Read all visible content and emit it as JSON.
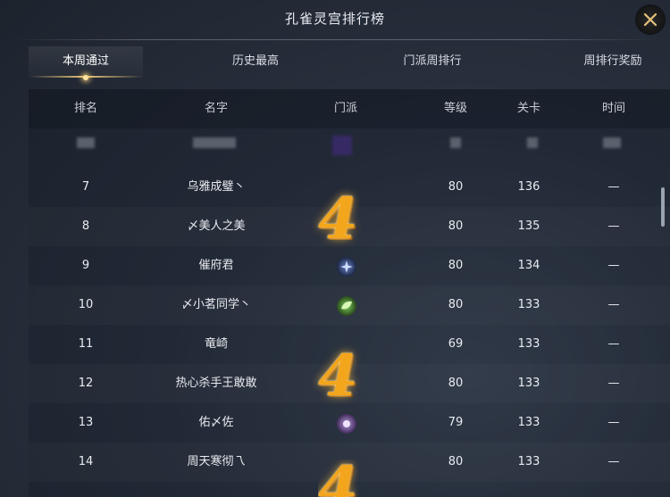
{
  "window": {
    "title": "孔雀灵宫排行榜"
  },
  "tabs": [
    {
      "label": "本周通过",
      "active": true
    },
    {
      "label": "历史最高",
      "active": false
    },
    {
      "label": "门派周排行",
      "active": false
    },
    {
      "label": "周排行奖励",
      "active": false
    }
  ],
  "table": {
    "headers": {
      "rank": "排名",
      "name": "名字",
      "sect": "门派",
      "level": "等级",
      "stage": "关卡",
      "time": "时间"
    },
    "rows": [
      {
        "rank": "7",
        "name": "乌雅成璧丶",
        "sect_icon": "none",
        "level": "80",
        "stage": "136",
        "time": "—"
      },
      {
        "rank": "8",
        "name": "〆美人之美",
        "sect_icon": "none",
        "level": "80",
        "stage": "135",
        "time": "—"
      },
      {
        "rank": "9",
        "name": "催府君",
        "sect_icon": "blue-star-icon",
        "level": "80",
        "stage": "134",
        "time": "—"
      },
      {
        "rank": "10",
        "name": "〆小茗同学丶",
        "sect_icon": "green-leaf-icon",
        "level": "80",
        "stage": "133",
        "time": "—"
      },
      {
        "rank": "11",
        "name": "竜崎",
        "sect_icon": "none",
        "level": "69",
        "stage": "133",
        "time": "—"
      },
      {
        "rank": "12",
        "name": "热心杀手王敢敢",
        "sect_icon": "none",
        "level": "80",
        "stage": "133",
        "time": "—"
      },
      {
        "rank": "13",
        "name": "佑〆佐",
        "sect_icon": "purple-orb-icon",
        "level": "79",
        "stage": "133",
        "time": "—"
      },
      {
        "rank": "14",
        "name": "周天寒彻乁",
        "sect_icon": "none",
        "level": "80",
        "stage": "133",
        "time": "—"
      }
    ]
  },
  "overlays": {
    "badge_text": "4"
  },
  "colors": {
    "accent_gold": "#e9c57a",
    "badge_orange": "#f3a51c",
    "bg": "#2a3240"
  }
}
